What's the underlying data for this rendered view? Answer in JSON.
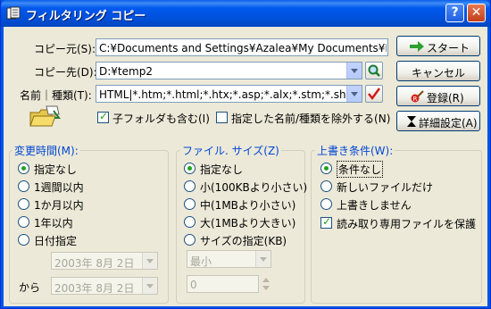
{
  "window": {
    "title": "フィルタリング コピー"
  },
  "source": {
    "label": "コピー元(S):",
    "value": "C:¥Documents and Settings¥Azalea¥My Documents¥Health.doc"
  },
  "dest": {
    "label": "コピー先(D):",
    "value": "D:¥temp2"
  },
  "name_type": {
    "label": "名前｜種類(T):",
    "value": "HTML|*.htm;*.html;*.htx;*.asp;*.alx;*.stm;*.shtml"
  },
  "options": {
    "include_subfolders": {
      "label": "子フォルダも含む(I)",
      "checked": true
    },
    "exclude_specified": {
      "label": "指定した名前/種類を除外する(N)",
      "checked": false
    }
  },
  "buttons": {
    "start": "スタート",
    "cancel": "キャンセル",
    "register": "登録(R)",
    "advanced": "詳細設定(A)"
  },
  "change_time": {
    "title": "変更時間(M):",
    "options": [
      "指定なし",
      "1週間以内",
      "1か月以内",
      "1年以内",
      "日付指定"
    ],
    "selected": 0,
    "date_from": "2003年  8月  2日",
    "date_to": "2003年  8月  2日",
    "to_label": "から"
  },
  "file_size": {
    "title": "ファイル. サイズ(Z)",
    "options": [
      "指定なし",
      "小(100KBより小さい)",
      "中(1MBより小さい)",
      "大(1MBより大きい)",
      "サイズの指定(KB)"
    ],
    "selected": 0,
    "size_op": "最小",
    "size_value": "0"
  },
  "overwrite": {
    "title": "上書き条件(W):",
    "options": [
      "条件なし",
      "新しいファイルだけ",
      "上書きしません"
    ],
    "selected": 0,
    "protect_readonly": {
      "label": "読み取り専用ファイルを保護",
      "checked": true
    }
  },
  "colors": {
    "title_bar": "#0054e3",
    "group_title": "#0046d5",
    "dialog_bg": "#ece9d8"
  }
}
